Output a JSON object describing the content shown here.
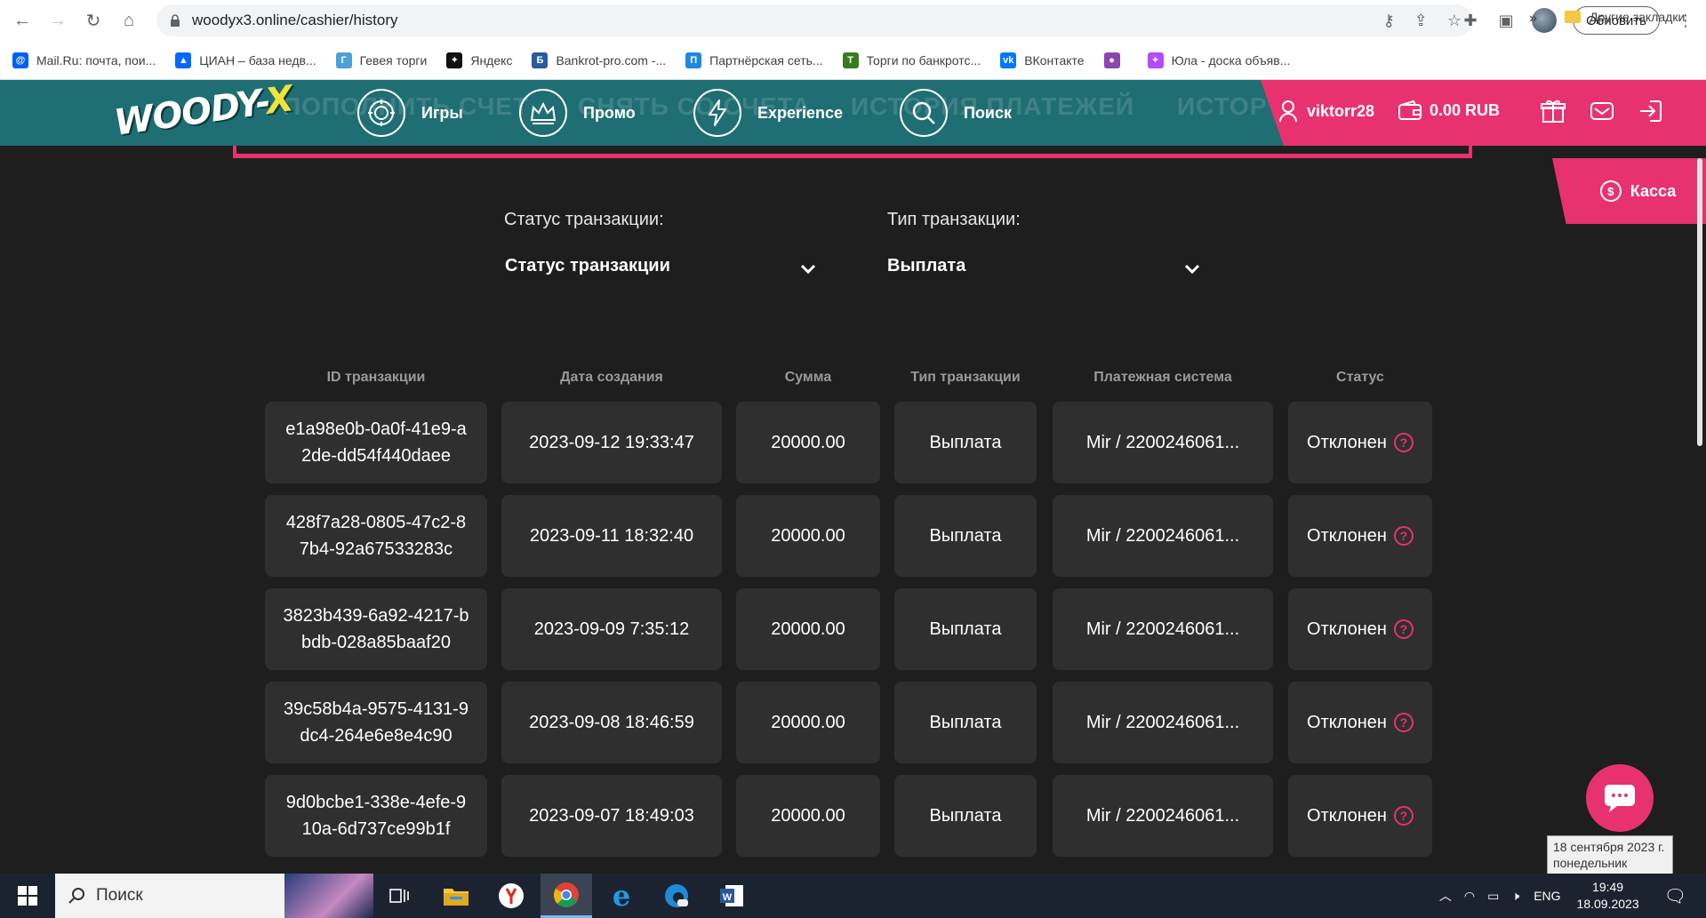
{
  "browser": {
    "url": "woodyx3.online/cashier/history",
    "update_label": "Обновить"
  },
  "bookmarks": [
    {
      "label": "Mail.Ru: почта, пои...",
      "color": "#005ff9",
      "glyph": "@"
    },
    {
      "label": "ЦИАН – база недв...",
      "color": "#0468ff",
      "glyph": "▲"
    },
    {
      "label": "Гевея торги",
      "color": "#4aa0d8",
      "glyph": "Г"
    },
    {
      "label": "Яндекс",
      "color": "#111111",
      "glyph": "✦"
    },
    {
      "label": "Bankrot-pro.com -...",
      "color": "#2a5aa0",
      "glyph": "Б"
    },
    {
      "label": "Партнёрская сеть...",
      "color": "#1e88e5",
      "glyph": "П"
    },
    {
      "label": "Торги по банкротс...",
      "color": "#3a7a20",
      "glyph": "Т"
    },
    {
      "label": "ВКонтакте",
      "color": "#0077ff",
      "glyph": "vk"
    },
    {
      "label": "",
      "color": "#8e44ad",
      "glyph": "●"
    },
    {
      "label": "Юла - доска объяв...",
      "color": "#b14cff",
      "glyph": "✦"
    }
  ],
  "bookmarks_more": "»",
  "bookmarks_other": "Другие закладки",
  "site": {
    "logo_main": "WOODY-",
    "logo_x": "X",
    "ghost_texts": [
      "ПОПОЛНИТЬ СЧЕТ",
      "СНЯТЬ СО СЧЕТА",
      "ИСТОРИЯ ПЛАТЕЖЕЙ",
      "ИСТОР"
    ],
    "nav": [
      {
        "label": "Игры",
        "icon": "games-icon"
      },
      {
        "label": "Промо",
        "icon": "crown-icon"
      },
      {
        "label": "Experience",
        "icon": "lightning-icon"
      },
      {
        "label": "Поиск",
        "icon": "search-icon"
      }
    ],
    "username": "viktorr28",
    "balance": "0.00 RUB",
    "kassa_label": "Касса",
    "accent": "#e8326f",
    "teal": "#1f6e73"
  },
  "filters": {
    "status_label": "Статус транзакции:",
    "status_value": "Статус транзакции",
    "type_label": "Тип транзакции:",
    "type_value": "Выплата"
  },
  "table": {
    "headers": [
      "ID транзакции",
      "Дата создания",
      "Сумма",
      "Тип транзакции",
      "Платежная система",
      "Статус"
    ],
    "rows": [
      {
        "id": "e1a98e0b-0a0f-41e9-a2de-dd54f440daee",
        "date": "2023-09-12 19:33:47",
        "amount": "20000.00",
        "type": "Выплата",
        "system": "Mir / 2200246061...",
        "status": "Отклонен"
      },
      {
        "id": "428f7a28-0805-47c2-87b4-92a67533283c",
        "date": "2023-09-11 18:32:40",
        "amount": "20000.00",
        "type": "Выплата",
        "system": "Mir / 2200246061...",
        "status": "Отклонен"
      },
      {
        "id": "3823b439-6a92-4217-bbdb-028a85baaf20",
        "date": "2023-09-09 7:35:12",
        "amount": "20000.00",
        "type": "Выплата",
        "system": "Mir / 2200246061...",
        "status": "Отклонен"
      },
      {
        "id": "39c58b4a-9575-4131-9dc4-264e6e8e4c90",
        "date": "2023-09-08 18:46:59",
        "amount": "20000.00",
        "type": "Выплата",
        "system": "Mir / 2200246061...",
        "status": "Отклонен"
      },
      {
        "id": "9d0bcbe1-338e-4efe-910a-6d737ce99b1f",
        "date": "2023-09-07 18:49:03",
        "amount": "20000.00",
        "type": "Выплата",
        "system": "Mir / 2200246061...",
        "status": "Отклонен"
      }
    ],
    "help_glyph": "?"
  },
  "tooltip": {
    "line1": "18 сентября 2023 г.",
    "line2": "понедельник"
  },
  "taskbar": {
    "search_label": "Поиск",
    "lang": "ENG",
    "time": "19:49",
    "date": "18.09.2023"
  }
}
